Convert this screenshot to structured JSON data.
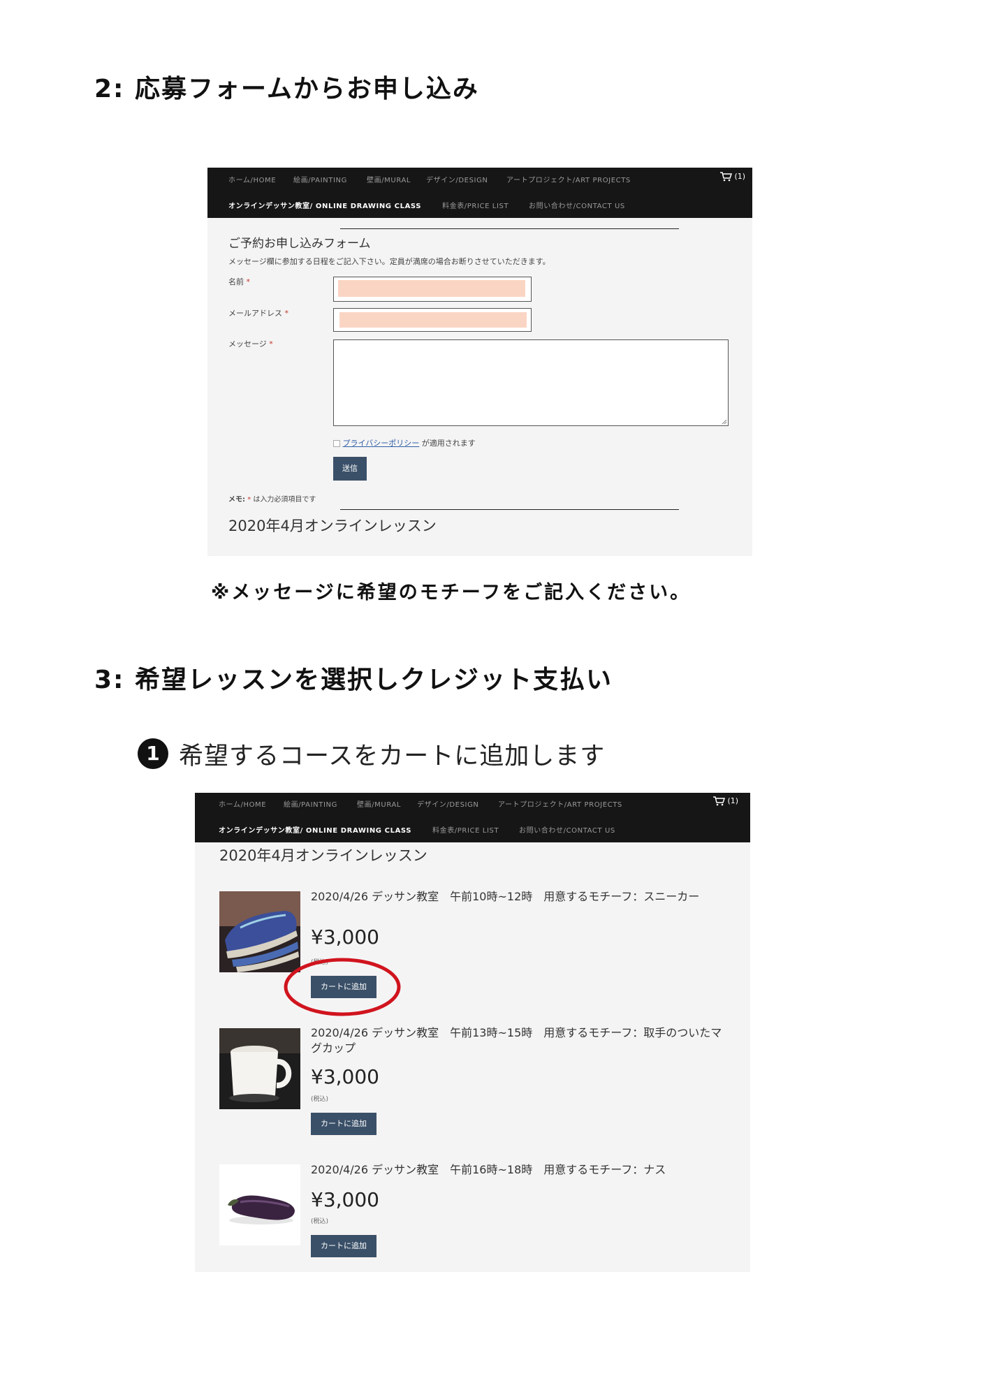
{
  "section2": {
    "heading": "2: 応募フォームからお申し込み",
    "note": "※メッセージに希望のモチーフをご記入ください。"
  },
  "section3": {
    "heading": "3: 希望レッスンを選択しクレジット支払い",
    "step_number": "1",
    "step_text": "希望するコースをカートに追加します"
  },
  "nav": {
    "row1": [
      "ホーム/HOME",
      "絵画/PAINTING",
      "壁画/MURAL",
      "デザイン/DESIGN",
      "アートプロジェクト/ART PROJECTS"
    ],
    "row2": [
      "オンラインデッサン教室/ ONLINE DRAWING CLASS",
      "料金表/PRICE LIST",
      "お問い合わせ/CONTACT US"
    ],
    "cart_count": "(1)"
  },
  "form": {
    "title": "ご予約お申し込みフォーム",
    "description": "メッセージ欄に参加する日程をご記入下さい。定員が満席の場合お断りさせていただきます。",
    "name_label": "名前",
    "email_label": "メールアドレス",
    "message_label": "メッセージ",
    "required_mark": "*",
    "privacy_link": "プライバシーポリシー",
    "privacy_suffix": "が適用されます",
    "submit_label": "送信",
    "memo_prefix": "メモ:",
    "memo_text": "は入力必須項目です",
    "next_title": "2020年4月オンラインレッスン"
  },
  "shop": {
    "title": "2020年4月オンラインレッスン",
    "products": [
      {
        "title": "2020/4/26 デッサン教室　午前10時~12時　用意するモチーフ：スニーカー",
        "price": "¥3,000",
        "tax": "(税込)",
        "button": "カートに追加",
        "image": "sneaker-photo"
      },
      {
        "title": "2020/4/26 デッサン教室　午前13時~15時　用意するモチーフ：取手のついたマグカップ",
        "price": "¥3,000",
        "tax": "(税込)",
        "button": "カートに追加",
        "image": "mug-photo"
      },
      {
        "title": "2020/4/26 デッサン教室　午前16時~18時　用意するモチーフ：ナス",
        "price": "¥3,000",
        "tax": "(税込)",
        "button": "カートに追加",
        "image": "eggplant-photo"
      }
    ],
    "highlight_color": "#d0141e"
  }
}
